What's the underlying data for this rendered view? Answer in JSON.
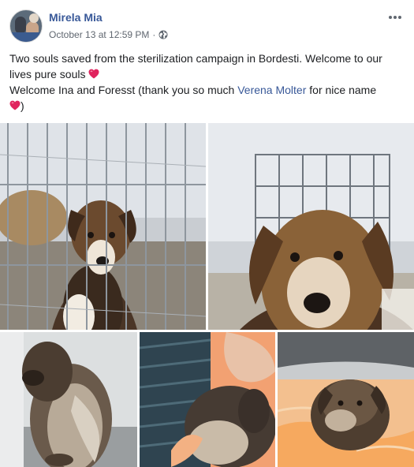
{
  "post": {
    "author": "Mirela Mia",
    "timestamp": "October 13 at 12:59 PM",
    "separator": "·",
    "privacy_icon": "globe-icon",
    "menu_icon": "more-options-icon",
    "text": {
      "line1_a": "Two souls saved from the sterilization campaign in Bordesti. Welcome to our lives pure souls",
      "line2_a": "Welcome Ina and Foresst (thank you so much",
      "mention": "Verena Molter",
      "line2_b": "for nice name",
      "line2_end": ")"
    },
    "emoji": "red-heart",
    "colors": {
      "author": "#385898",
      "meta": "#606770",
      "heart": "#e0245e"
    },
    "photos": [
      {
        "name": "puppy-in-crate"
      },
      {
        "name": "puppy-closeup"
      },
      {
        "name": "puppy-fluffy-tail"
      },
      {
        "name": "puppy-being-petted"
      },
      {
        "name": "puppy-on-blanket"
      }
    ]
  }
}
